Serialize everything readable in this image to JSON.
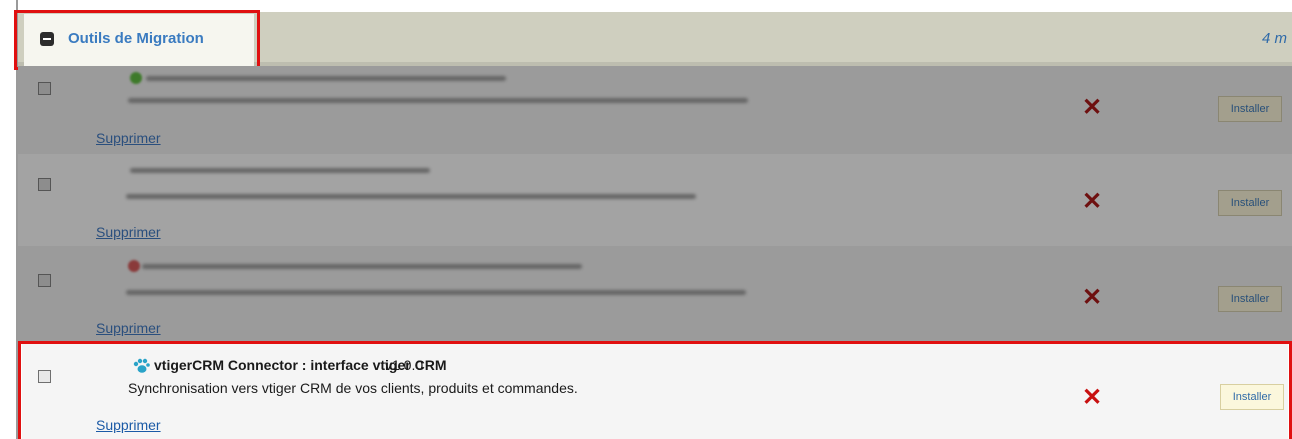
{
  "section": {
    "title": "Outils de Migration",
    "count_text": "4 m"
  },
  "rows": [
    {
      "delete_label": "Supprimer",
      "install_label": "Installer"
    },
    {
      "delete_label": "Supprimer",
      "install_label": "Installer"
    },
    {
      "delete_label": "Supprimer",
      "install_label": "Installer"
    },
    {
      "name": "vtigerCRM Connector : interface vtiger CRM",
      "version": "v1.0.0",
      "description": "Synchronisation vers vtiger CRM de vos clients, produits et commandes.",
      "delete_label": "Supprimer",
      "install_label": "Installer"
    }
  ],
  "icons": {
    "toggle": "collapse-icon",
    "remove": "red-x-icon",
    "module": "paw-icon"
  },
  "colors": {
    "highlight_border": "#e01010",
    "link": "#1b5aa6",
    "remove_x": "#c81010",
    "install_bg": "#fbf7dc"
  }
}
